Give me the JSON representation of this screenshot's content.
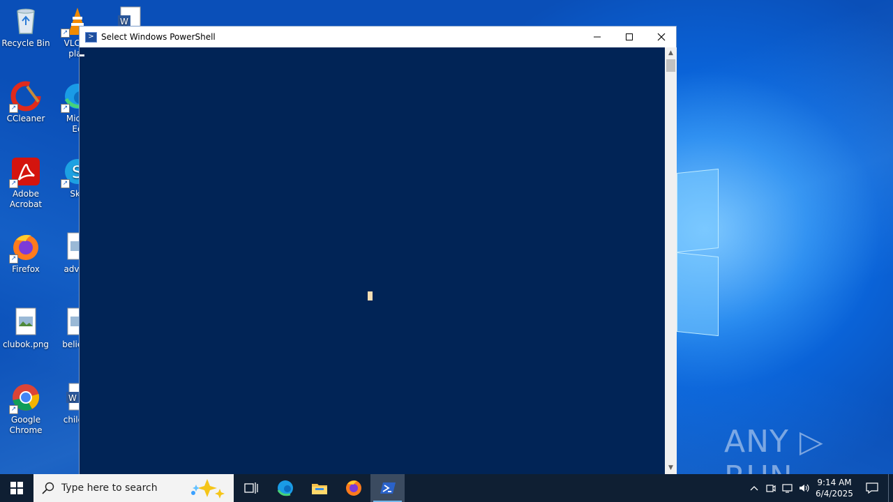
{
  "desktop": {
    "icons": [
      {
        "label": "Recycle Bin"
      },
      {
        "label": "VLC m\nplay"
      },
      {
        "label": "CCleaner"
      },
      {
        "label": "Micro\nEd"
      },
      {
        "label": "Adobe\nAcrobat"
      },
      {
        "label": "Sky"
      },
      {
        "label": "Firefox"
      },
      {
        "label": "advert"
      },
      {
        "label": "clubok.png"
      },
      {
        "label": "believe"
      },
      {
        "label": "Google\nChrome"
      },
      {
        "label": "childre"
      }
    ]
  },
  "window": {
    "title": "Select Windows PowerShell",
    "minimize_icon": "minimize-icon",
    "maximize_icon": "maximize-icon",
    "close_icon": "close-icon",
    "console_bg": "#012456"
  },
  "taskbar": {
    "search_placeholder": "Type here to search",
    "apps": [
      "task-view",
      "edge",
      "file-explorer",
      "firefox",
      "powershell"
    ],
    "clock_time": "9:14 AM",
    "clock_date": "6/4/2025"
  },
  "watermark": "ANY ▷ RUN"
}
